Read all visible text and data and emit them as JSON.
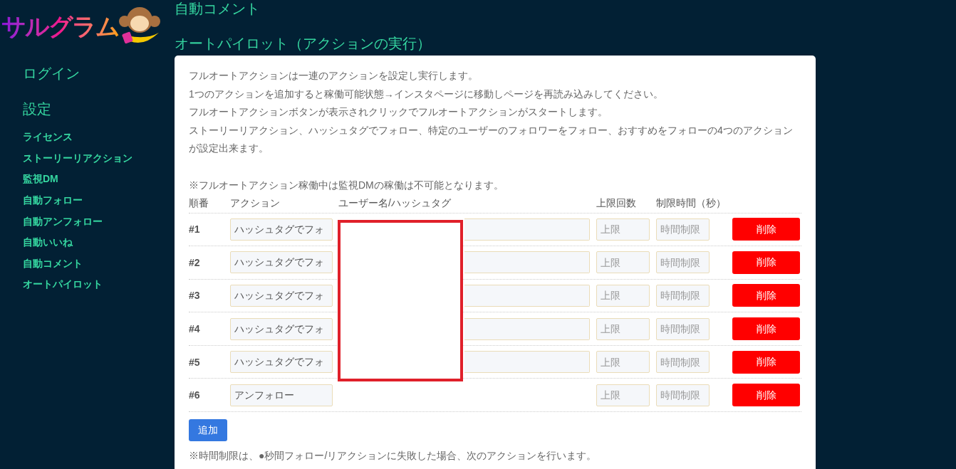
{
  "logo": {
    "text": "サルグラム"
  },
  "sidebar": {
    "items": [
      {
        "label": "ログイン",
        "kind": "large"
      },
      {
        "label": "設定",
        "kind": "large"
      },
      {
        "label": "ライセンス",
        "kind": "small"
      },
      {
        "label": "ストーリーリアクション",
        "kind": "small"
      },
      {
        "label": "監視DM",
        "kind": "small"
      },
      {
        "label": "自動フォロー",
        "kind": "small"
      },
      {
        "label": "自動アンフォロー",
        "kind": "small"
      },
      {
        "label": "自動いいね",
        "kind": "small"
      },
      {
        "label": "自動コメント",
        "kind": "small"
      },
      {
        "label": "オートパイロット",
        "kind": "small"
      }
    ]
  },
  "headings": [
    "自動コメント",
    "オートパイロット（アクションの実行）"
  ],
  "card": {
    "intro": [
      "フルオートアクションは一連のアクションを設定し実行します。",
      "1つのアクションを追加すると稼働可能状態→インスタページに移動しページを再読み込みしてください。",
      "フルオートアクションボタンが表示されクリックでフルオートアクションがスタートします。",
      "ストーリーリアクション、ハッシュタグでフォロー、特定のユーザーのフォロワーをフォロー、おすすめをフォローの4つのアクションが設定出来ます。"
    ],
    "note": "※フルオートアクション稼働中は監視DMの稼働は不可能となります。",
    "table": {
      "columns": [
        "順番",
        "アクション",
        "ユーザー名/ハッシュタグ",
        "上限回数",
        "制限時間（秒）"
      ],
      "rows": [
        {
          "number": "#1",
          "action": "ハッシュタグでフォ",
          "username_field": true,
          "limit_placeholder": "上限",
          "time_placeholder": "時間制限",
          "button": "削除"
        },
        {
          "number": "#2",
          "action": "ハッシュタグでフォ",
          "username_field": true,
          "limit_placeholder": "上限",
          "time_placeholder": "時間制限",
          "button": "削除"
        },
        {
          "number": "#3",
          "action": "ハッシュタグでフォ",
          "username_field": true,
          "limit_placeholder": "上限",
          "time_placeholder": "時間制限",
          "button": "削除"
        },
        {
          "number": "#4",
          "action": "ハッシュタグでフォ",
          "username_field": true,
          "limit_placeholder": "上限",
          "time_placeholder": "時間制限",
          "button": "削除"
        },
        {
          "number": "#5",
          "action": "ハッシュタグでフォ",
          "username_field": true,
          "limit_placeholder": "上限",
          "time_placeholder": "時間制限",
          "button": "削除"
        },
        {
          "number": "#6",
          "action": "アンフォロー",
          "username_field": false,
          "limit_placeholder": "上限",
          "time_placeholder": "時間制限",
          "button": "削除"
        }
      ]
    },
    "add_button": "追加",
    "footnote": "※時間制限は、●秒間フォロー/リアクションに失敗した場合、次のアクションを行います。"
  }
}
